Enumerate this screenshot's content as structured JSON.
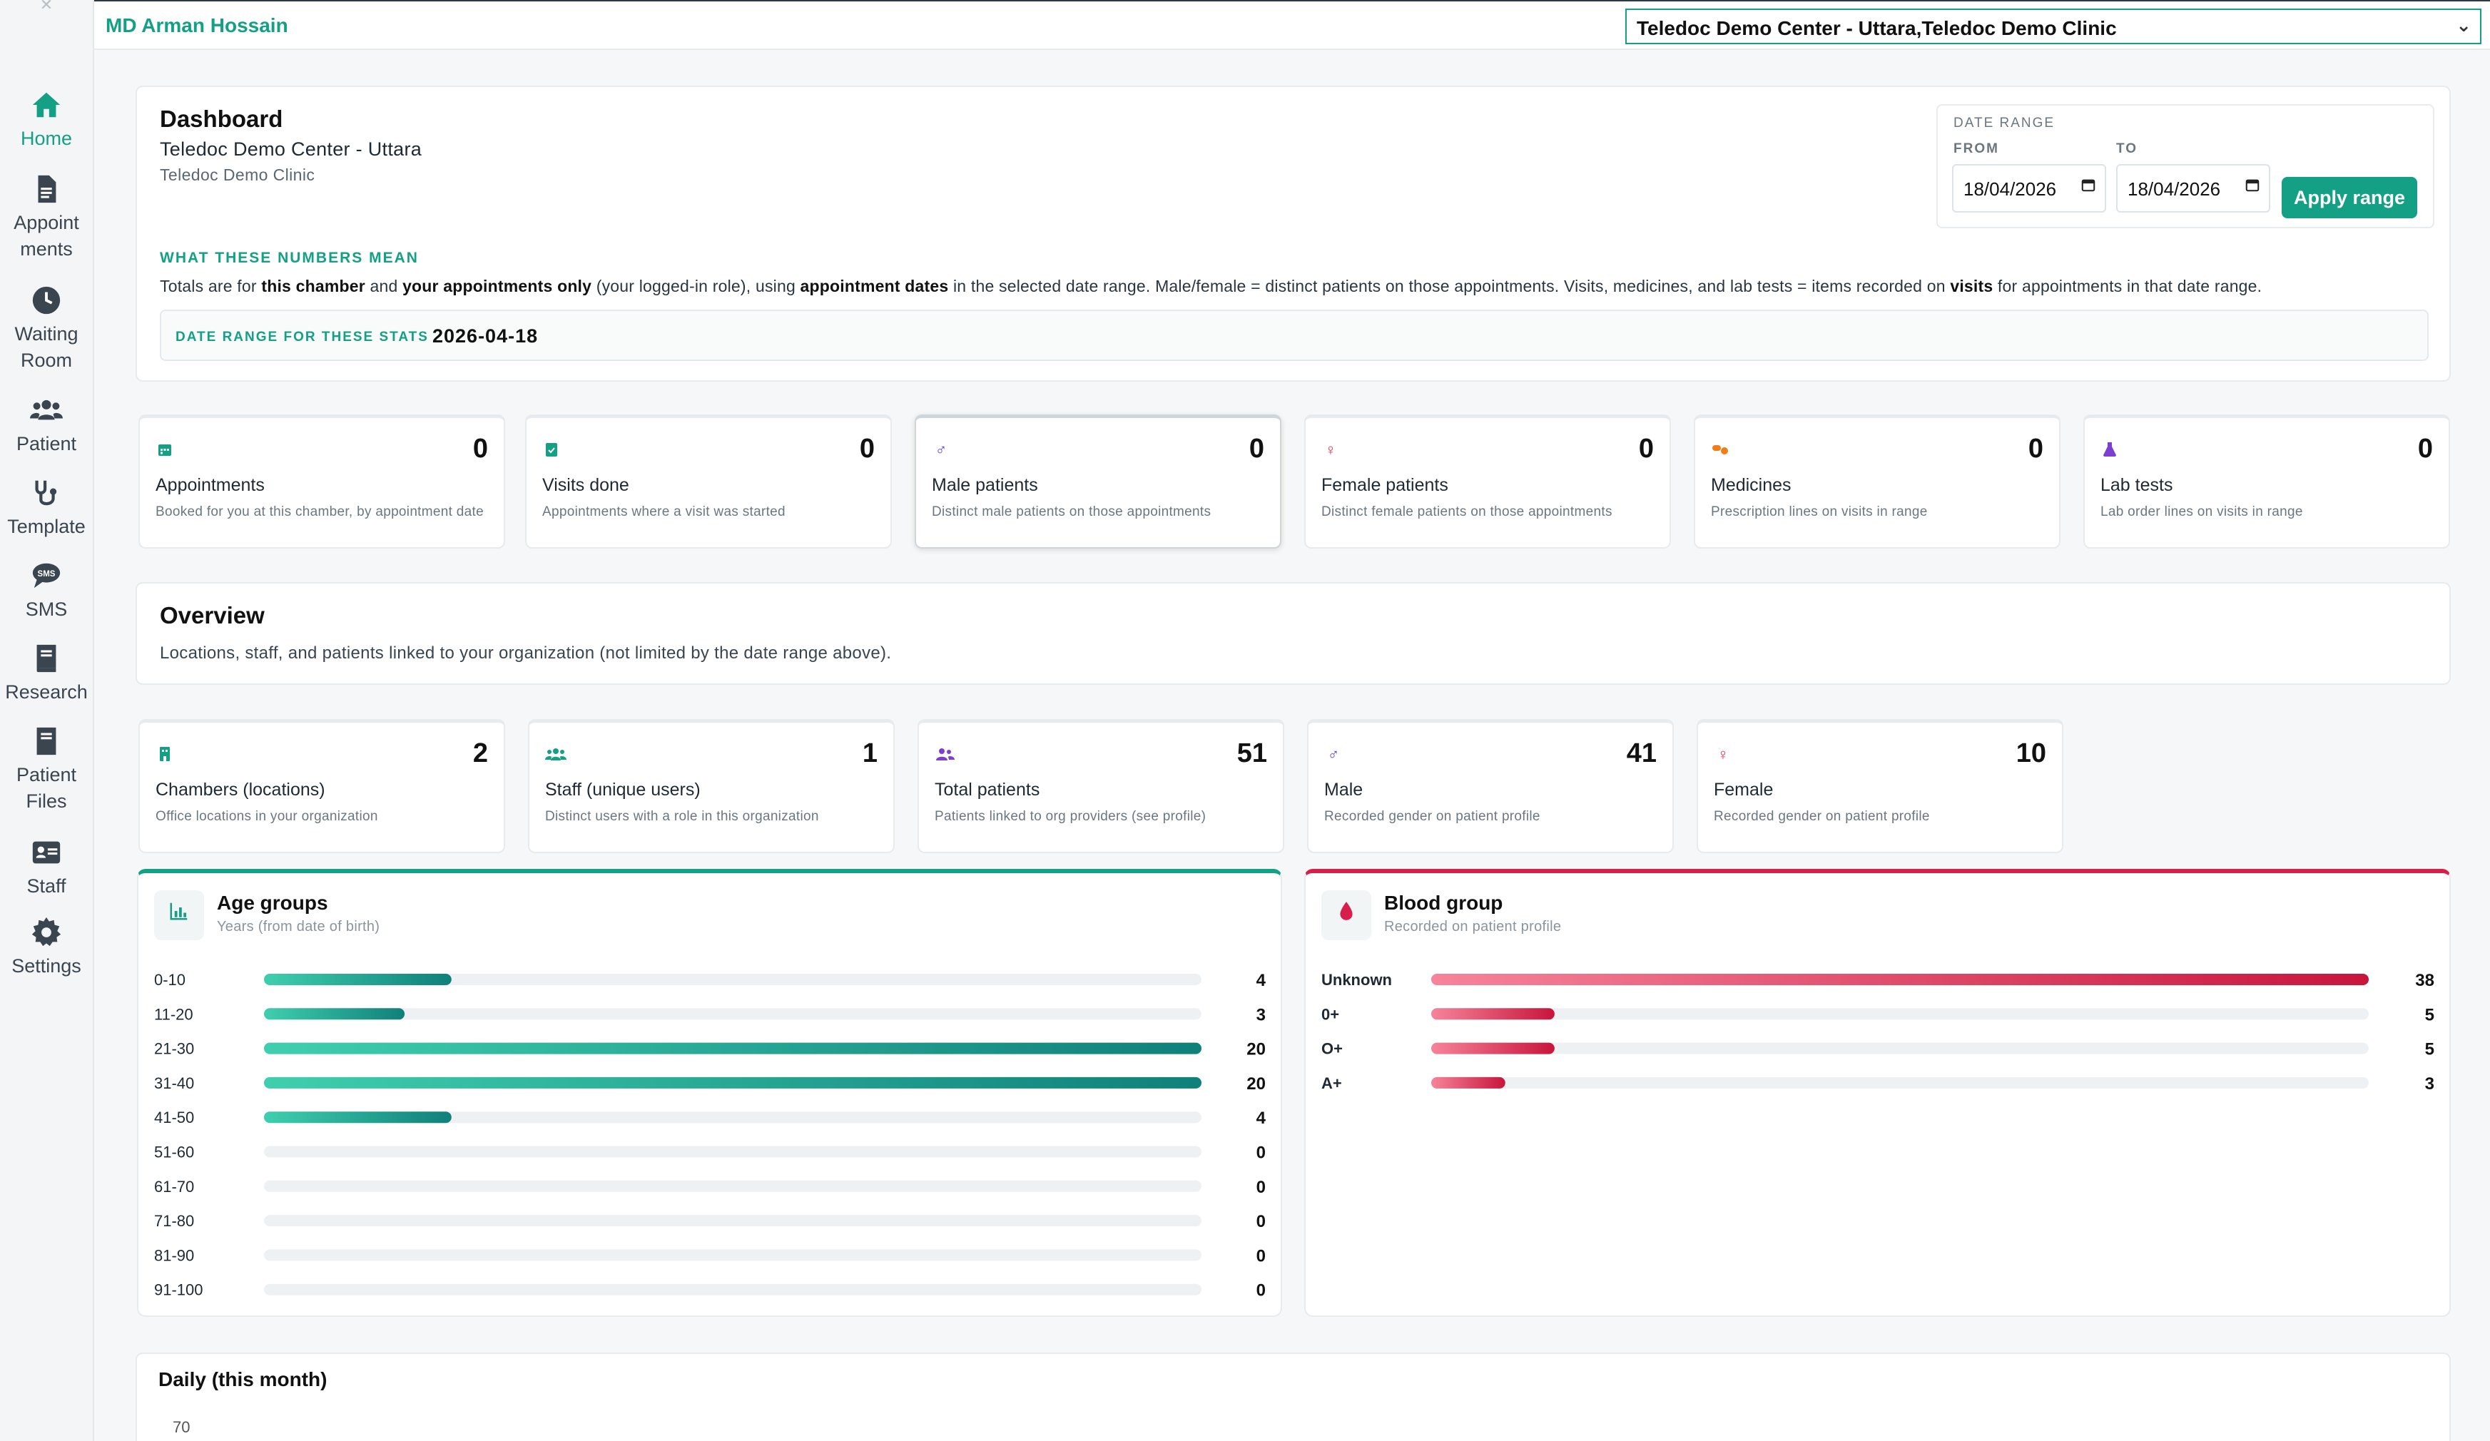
{
  "sidebar": {
    "items": [
      {
        "label": "Home",
        "icon": "home-icon",
        "active": true
      },
      {
        "label": "Appoint ments",
        "line1": "Appoint",
        "line2": "ments",
        "icon": "document-icon"
      },
      {
        "label": "Waiting Room",
        "line1": "Waiting",
        "line2": "Room",
        "icon": "clock-icon"
      },
      {
        "label": "Patient",
        "icon": "users-icon"
      },
      {
        "label": "Template",
        "icon": "stethoscope-icon"
      },
      {
        "label": "SMS",
        "icon": "sms-icon"
      },
      {
        "label": "Research",
        "icon": "book-icon"
      },
      {
        "label": "Patient Files",
        "line1": "Patient",
        "line2": "Files",
        "icon": "file-icon"
      },
      {
        "label": "Staff",
        "icon": "id-card-icon"
      },
      {
        "label": "Settings",
        "icon": "gear-icon"
      }
    ]
  },
  "header": {
    "user_name": "MD Arman Hossain",
    "center_select": "Teledoc Demo Center - Uttara,Teledoc Demo Clinic"
  },
  "dashboard": {
    "title": "Dashboard",
    "center": "Teledoc Demo Center - Uttara",
    "clinic": "Teledoc Demo Clinic",
    "date_range": {
      "label": "DATE RANGE",
      "from_label": "FROM",
      "to_label": "TO",
      "from": "18/04/2026",
      "to": "18/04/2026",
      "apply": "Apply range"
    },
    "meaning_title": "WHAT THESE NUMBERS MEAN",
    "meaning": {
      "t1": "Totals are for ",
      "b1": "this chamber",
      "t2": " and ",
      "b2": "your appointments only",
      "t3": " (your logged-in role), using ",
      "b3": "appointment dates",
      "t4": " in the selected date range. Male/female = distinct patients on those appointments. Visits, medicines, and lab tests = items recorded on ",
      "b4": "visits",
      "t5": " for appointments in that date range."
    },
    "stats_range_label": "DATE RANGE FOR THESE STATS",
    "stats_range_value": "2026-04-18"
  },
  "stats": [
    {
      "label": "Appointments",
      "value": "0",
      "desc": "Booked for you at this chamber, by appointment date",
      "icon": "calendar-icon",
      "color": "#14a085"
    },
    {
      "label": "Visits done",
      "value": "0",
      "desc": "Appointments where a visit was started",
      "icon": "clipboard-icon",
      "color": "#1ba0d8"
    },
    {
      "label": "Male patients",
      "value": "0",
      "desc": "Distinct male patients on those appointments",
      "icon": "male-icon",
      "color": "#7c5cf0"
    },
    {
      "label": "Female patients",
      "value": "0",
      "desc": "Distinct female patients on those appointments",
      "icon": "female-icon",
      "color": "#e0304f"
    },
    {
      "label": "Medicines",
      "value": "0",
      "desc": "Prescription lines on visits in range",
      "icon": "pills-icon",
      "color": "#f07d1a"
    },
    {
      "label": "Lab tests",
      "value": "0",
      "desc": "Lab order lines on visits in range",
      "icon": "flask-icon",
      "color": "#7c3fd0"
    }
  ],
  "overview": {
    "title": "Overview",
    "subtitle": "Locations, staff, and patients linked to your organization (not limited by the date range above).",
    "stats": [
      {
        "label": "Chambers (locations)",
        "value": "2",
        "desc": "Office locations in your organization",
        "icon": "building-icon",
        "color": "#1ba0d8"
      },
      {
        "label": "Staff (unique users)",
        "value": "1",
        "desc": "Distinct users with a role in this organization",
        "icon": "staff-icon",
        "color": "#1ba0d8"
      },
      {
        "label": "Total patients",
        "value": "51",
        "desc": "Patients linked to org providers (see profile)",
        "icon": "users-icon",
        "color": "#7c3fd0"
      },
      {
        "label": "Male",
        "value": "41",
        "desc": "Recorded gender on patient profile",
        "icon": "male-icon",
        "color": "#3b5bdb"
      },
      {
        "label": "Female",
        "value": "10",
        "desc": "Recorded gender on patient profile",
        "icon": "female-icon",
        "color": "#e0304f"
      }
    ]
  },
  "chart_data": [
    {
      "type": "bar",
      "orientation": "horizontal",
      "title": "Age groups",
      "subtitle": "Years (from date of birth)",
      "categories": [
        "0-10",
        "11-20",
        "21-30",
        "31-40",
        "41-50",
        "51-60",
        "61-70",
        "71-80",
        "81-90",
        "91-100"
      ],
      "values": [
        4,
        3,
        20,
        20,
        4,
        0,
        0,
        0,
        0,
        0
      ],
      "xlim": [
        0,
        20
      ],
      "color": "#14a085"
    },
    {
      "type": "bar",
      "orientation": "horizontal",
      "title": "Blood group",
      "subtitle": "Recorded on patient profile",
      "categories": [
        "Unknown",
        "0+",
        "O+",
        "A+"
      ],
      "values": [
        38,
        5,
        5,
        3
      ],
      "xlim": [
        0,
        38
      ],
      "color": "#d81e4a"
    }
  ],
  "daily": {
    "title": "Daily (this month)",
    "y_top": "70"
  }
}
